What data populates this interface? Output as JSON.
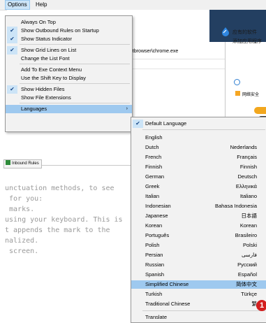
{
  "menubar": {
    "options": "Options",
    "help": "Help"
  },
  "canvas": {
    "path_text": "ntbrowser\\chrome.exe",
    "inbound_tab": "Inbound Rules"
  },
  "side_panel": {
    "line1": "应有的软件",
    "line2": "添加应用程序",
    "security_label": "网络安全"
  },
  "mono_text": "unctuation methods, to see\n for you:\n marks.\nusing your keyboard. This is\nt appends the mark to the\nnalized.\n screen.",
  "options_menu": {
    "items": [
      {
        "label": "Always On Top",
        "checked": false
      },
      {
        "label": "Show Outbound Rules on Startup",
        "checked": true
      },
      {
        "label": "Show Status Indicator",
        "checked": true
      },
      {
        "label": "Show Grid Lines on List",
        "checked": true
      },
      {
        "label": "Change the List Font",
        "checked": false
      },
      {
        "label": "Add To Exe Context Menu",
        "checked": false
      },
      {
        "label": "Use the Shift Key to Display",
        "checked": false
      },
      {
        "label": "Show Hidden Files",
        "checked": true
      },
      {
        "label": "Show File Extensions",
        "checked": false
      },
      {
        "label": "Languages",
        "checked": false,
        "arrow": "›",
        "highlighted": true
      }
    ]
  },
  "languages_menu": {
    "items": [
      {
        "label": "Default Language",
        "native": "",
        "checked": true
      },
      {
        "label": "English",
        "native": ""
      },
      {
        "label": "Dutch",
        "native": "Nederlands"
      },
      {
        "label": "French",
        "native": "Français"
      },
      {
        "label": "Finnish",
        "native": "Finnish"
      },
      {
        "label": "German",
        "native": "Deutsch"
      },
      {
        "label": "Greek",
        "native": "Ελληνικά"
      },
      {
        "label": "Italian",
        "native": "Italiano"
      },
      {
        "label": "Indonesian",
        "native": "Bahasa Indonesia"
      },
      {
        "label": "Japanese",
        "native": "日本語"
      },
      {
        "label": "Korean",
        "native": "Korean"
      },
      {
        "label": "Português",
        "native": "Brasileiro"
      },
      {
        "label": "Polish",
        "native": "Polski"
      },
      {
        "label": "Persian",
        "native": "فارسی"
      },
      {
        "label": "Russian",
        "native": "Русский"
      },
      {
        "label": "Spanish",
        "native": "Español"
      },
      {
        "label": "Simplified Chinese",
        "native": "简体中文",
        "highlighted": true
      },
      {
        "label": "Turkish",
        "native": "Türkçe"
      },
      {
        "label": "Traditional Chinese",
        "native": "繁"
      },
      {
        "label": "Translate",
        "native": ""
      }
    ]
  },
  "callout": "1",
  "colors": {
    "menu_highlight": "#9ec9ef",
    "check_bg": "#cce4f7",
    "callout": "#d31f1f",
    "side_dark": "#233f61"
  }
}
